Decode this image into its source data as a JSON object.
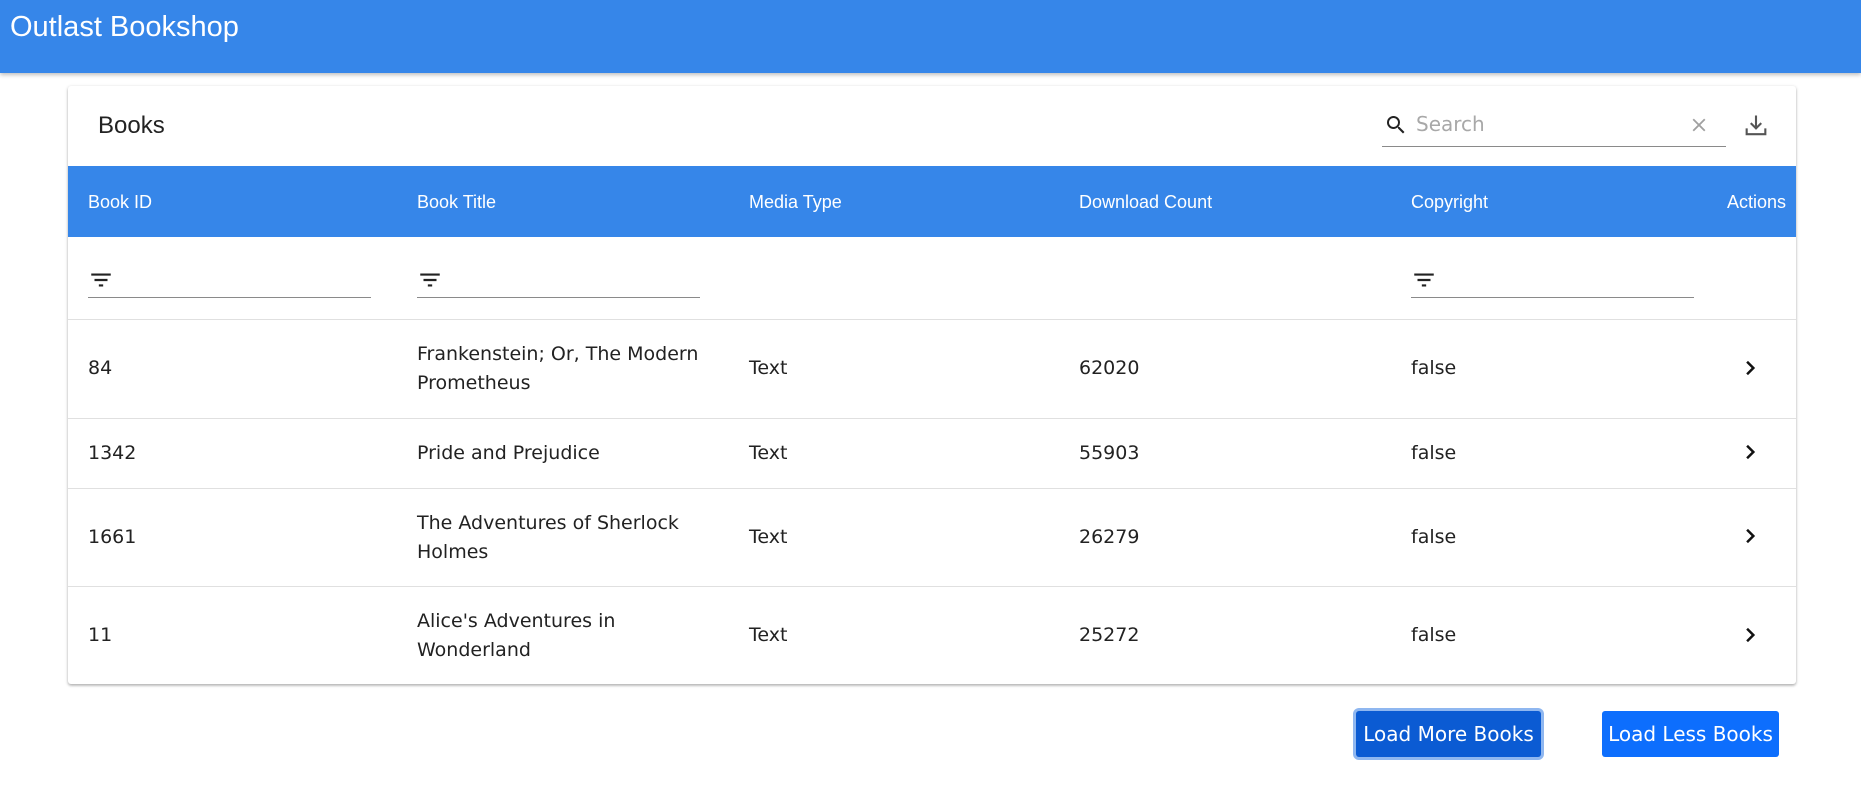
{
  "app": {
    "title": "Outlast Bookshop"
  },
  "table": {
    "title": "Books",
    "search_placeholder": "Search",
    "columns": [
      "Book ID",
      "Book Title",
      "Media Type",
      "Download Count",
      "Copyright",
      "Actions"
    ],
    "rows": [
      {
        "id": "84",
        "title_line1": "Frankenstein; Or, The Modern",
        "title_line2": "Prometheus",
        "media": "Text",
        "downloads": "62020",
        "copyright": "false"
      },
      {
        "id": "1342",
        "title_line1": "Pride and Prejudice",
        "title_line2": "",
        "media": "Text",
        "downloads": "55903",
        "copyright": "false"
      },
      {
        "id": "1661",
        "title_line1": "The Adventures of Sherlock",
        "title_line2": "Holmes",
        "media": "Text",
        "downloads": "26279",
        "copyright": "false"
      },
      {
        "id": "11",
        "title_line1": "Alice's Adventures in",
        "title_line2": "Wonderland",
        "media": "Text",
        "downloads": "25272",
        "copyright": "false"
      }
    ]
  },
  "buttons": {
    "load_more": "Load More Books",
    "load_less": "Load Less Books"
  },
  "colors": {
    "header_blue": "#3686e9",
    "button_primary": "#0d6efd",
    "button_focused": "#0b5bd3"
  },
  "icons": {
    "search": "search-icon",
    "clear": "close-icon",
    "download": "download-icon",
    "filter": "filter-icon",
    "row_action": "chevron-right-icon"
  }
}
